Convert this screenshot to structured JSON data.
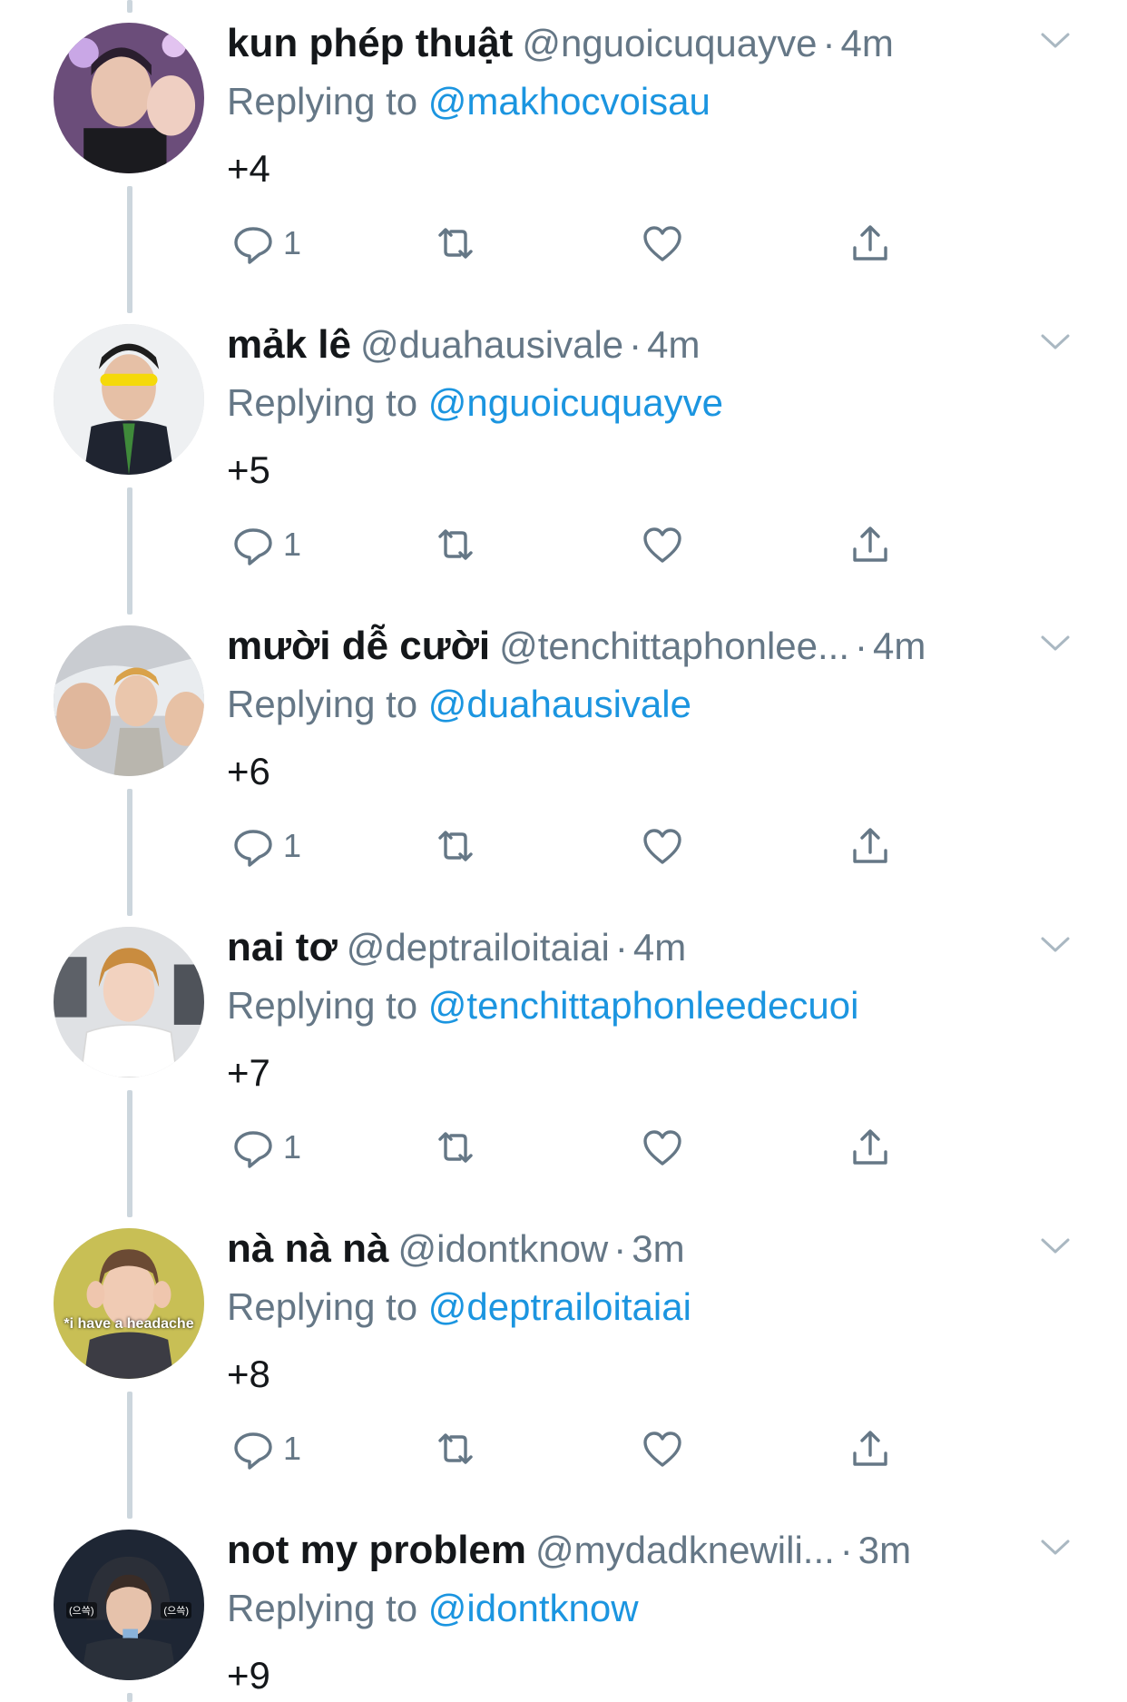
{
  "tweets": [
    {
      "name": "kun phép thuật",
      "handle": "@nguoicuquayve",
      "dot": "·",
      "time": "4m",
      "replying_label": "Replying to",
      "replying_to": "@makhocvoisau",
      "text": "+4",
      "reply_count": "1",
      "avatar_caption": ""
    },
    {
      "name": "mảk lê",
      "handle": "@duahausivale",
      "dot": "·",
      "time": "4m",
      "replying_label": "Replying to",
      "replying_to": "@nguoicuquayve",
      "text": "+5",
      "reply_count": "1",
      "avatar_caption": ""
    },
    {
      "name": "mười dễ cười",
      "handle": "@tenchittaphonlee...",
      "dot": "·",
      "time": "4m",
      "replying_label": "Replying to",
      "replying_to": "@duahausivale",
      "text": "+6",
      "reply_count": "1",
      "avatar_caption": ""
    },
    {
      "name": "nai tơ",
      "handle": "@deptrailoitaiai",
      "dot": "·",
      "time": "4m",
      "replying_label": "Replying to",
      "replying_to": "@tenchittaphonleedecuoi",
      "text": "+7",
      "reply_count": "1",
      "avatar_caption": ""
    },
    {
      "name": "nà nà nà",
      "handle": "@idontknow",
      "dot": "·",
      "time": "3m",
      "replying_label": "Replying to",
      "replying_to": "@deptrailoitaiai",
      "text": "+8",
      "reply_count": "1",
      "avatar_caption": "*i have a headache"
    },
    {
      "name": "not my problem",
      "handle": "@mydadknewili...",
      "dot": "·",
      "time": "3m",
      "replying_label": "Replying to",
      "replying_to": "@idontknow",
      "text": "+9",
      "reply_count": "",
      "avatar_caption": "",
      "avatar_tags": [
        "(으쓱)",
        "(으쓱)"
      ]
    }
  ],
  "colors": {
    "name": "#14171a",
    "secondary": "#657786",
    "mention": "#1b95e0",
    "thread_line": "#ccd6dd"
  },
  "icons": [
    "reply-icon",
    "retweet-icon",
    "like-icon",
    "share-icon",
    "chevron-down-icon"
  ]
}
